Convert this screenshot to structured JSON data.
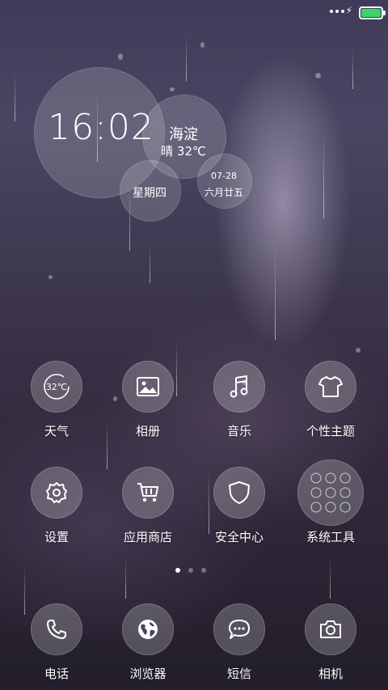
{
  "status_bar": {
    "battery_level": 1.0,
    "battery_color": "#38d46c"
  },
  "widget": {
    "time": "16:02",
    "city": "海淀",
    "weather": "晴 32℃",
    "weekday": "星期四",
    "date": "07-28",
    "lunar_date": "六月廿五"
  },
  "apps": [
    {
      "label": "天气",
      "icon": "weather-icon",
      "icon_text": "32℃"
    },
    {
      "label": "相册",
      "icon": "photo-icon"
    },
    {
      "label": "音乐",
      "icon": "music-note-icon"
    },
    {
      "label": "个性主题",
      "icon": "tshirt-icon"
    },
    {
      "label": "设置",
      "icon": "gear-icon"
    },
    {
      "label": "应用商店",
      "icon": "shopping-cart-icon"
    },
    {
      "label": "安全中心",
      "icon": "shield-icon"
    },
    {
      "label": "系统工具",
      "icon": "folder-grid-icon"
    }
  ],
  "pager": {
    "pages": 3,
    "active": 1
  },
  "dock": [
    {
      "label": "电话",
      "icon": "phone-icon"
    },
    {
      "label": "浏览器",
      "icon": "globe-icon"
    },
    {
      "label": "短信",
      "icon": "chat-bubble-icon"
    },
    {
      "label": "相机",
      "icon": "camera-icon"
    }
  ]
}
